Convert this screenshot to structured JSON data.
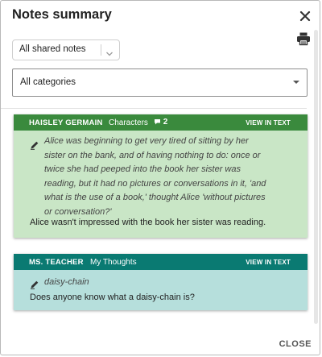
{
  "header": {
    "title": "Notes summary",
    "close_icon": "close-icon",
    "print_icon": "print-icon"
  },
  "filters": {
    "shared": {
      "selected": "All shared notes",
      "icon": "chevron-down-icon"
    },
    "category": {
      "selected": "All categories",
      "icon": "caret-down-icon"
    }
  },
  "notes": [
    {
      "author": "HAISLEY GERMAIN",
      "category": "Characters",
      "comment_count": "2",
      "view_label": "VIEW IN TEXT",
      "header_color": "#3a8a3d",
      "body_color": "#c9e6c6",
      "quote_lines": [
        "Alice was beginning to get very tired of sitting by her",
        "sister on the bank, and of having nothing to do: once or",
        "twice she had peeped into the book her sister was",
        "reading, but it had no pictures or conversations in it, 'and",
        "what is the use of a book,' thought Alice 'without pictures",
        "or conversation?'"
      ],
      "comment": "Alice wasn't impressed with the book her sister was reading."
    },
    {
      "author": "MS. TEACHER",
      "category": "My Thoughts",
      "view_label": "VIEW IN TEXT",
      "header_color": "#0a7a72",
      "body_color": "#b6dfdc",
      "quote_lines": [
        "daisy-chain"
      ],
      "comment": "Does anyone know what a daisy-chain is?"
    }
  ],
  "footer": {
    "close_label": "CLOSE"
  }
}
